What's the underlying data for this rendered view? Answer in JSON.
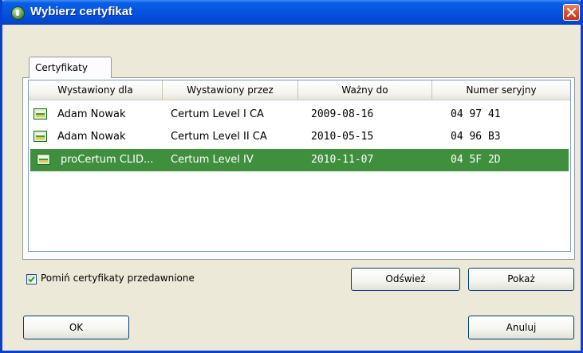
{
  "window": {
    "title": "Wybierz certyfikat"
  },
  "tabs": [
    {
      "label": "Certyfikaty"
    }
  ],
  "table": {
    "columns": [
      "Wystawiony dla",
      "Wystawiony przez",
      "Ważny do",
      "Numer seryjny"
    ],
    "rows": [
      {
        "issued_to": "Adam Nowak",
        "issued_by": "Certum Level I CA",
        "valid_to": "2009-08-16",
        "serial": "04 97 41",
        "selected": false
      },
      {
        "issued_to": "Adam Nowak",
        "issued_by": "Certum Level II CA",
        "valid_to": "2010-05-15",
        "serial": "04 96 B3",
        "selected": false
      },
      {
        "issued_to": "proCertum CLID...",
        "issued_by": "Certum Level IV",
        "valid_to": "2010-11-07",
        "serial": "04 5F 2D",
        "selected": true
      }
    ]
  },
  "skip_expired": {
    "label": "Pomiń certyfikaty przedawnione",
    "checked": true
  },
  "buttons": {
    "refresh": "Odśwież",
    "show": "Pokaż",
    "ok": "OK",
    "cancel": "Anuluj"
  },
  "colors": {
    "selection": "#3f8f3f",
    "title_bar": "#0553e0",
    "close_button": "#d2532f"
  },
  "icons": {
    "app": "certum-app-icon",
    "close": "close-icon",
    "certificate": "certificate-icon",
    "check": "checkmark-icon"
  }
}
